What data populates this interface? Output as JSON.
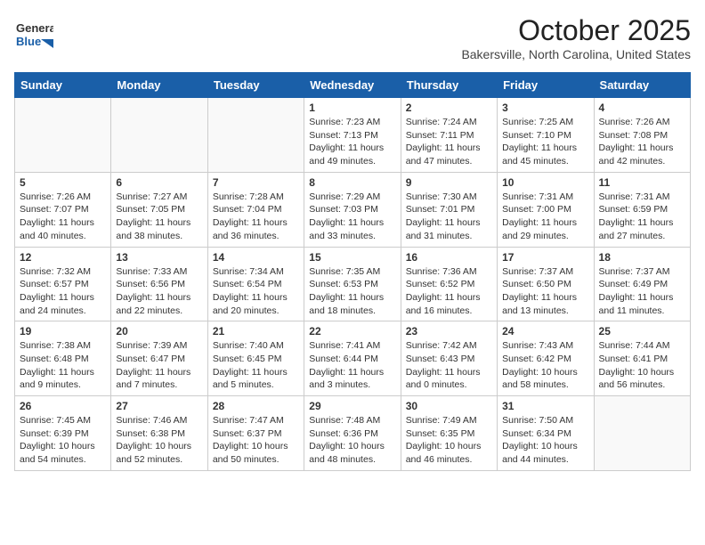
{
  "header": {
    "logo_general": "General",
    "logo_blue": "Blue",
    "month": "October 2025",
    "location": "Bakersville, North Carolina, United States"
  },
  "days_of_week": [
    "Sunday",
    "Monday",
    "Tuesday",
    "Wednesday",
    "Thursday",
    "Friday",
    "Saturday"
  ],
  "weeks": [
    [
      {
        "num": "",
        "info": ""
      },
      {
        "num": "",
        "info": ""
      },
      {
        "num": "",
        "info": ""
      },
      {
        "num": "1",
        "info": "Sunrise: 7:23 AM\nSunset: 7:13 PM\nDaylight: 11 hours and 49 minutes."
      },
      {
        "num": "2",
        "info": "Sunrise: 7:24 AM\nSunset: 7:11 PM\nDaylight: 11 hours and 47 minutes."
      },
      {
        "num": "3",
        "info": "Sunrise: 7:25 AM\nSunset: 7:10 PM\nDaylight: 11 hours and 45 minutes."
      },
      {
        "num": "4",
        "info": "Sunrise: 7:26 AM\nSunset: 7:08 PM\nDaylight: 11 hours and 42 minutes."
      }
    ],
    [
      {
        "num": "5",
        "info": "Sunrise: 7:26 AM\nSunset: 7:07 PM\nDaylight: 11 hours and 40 minutes."
      },
      {
        "num": "6",
        "info": "Sunrise: 7:27 AM\nSunset: 7:05 PM\nDaylight: 11 hours and 38 minutes."
      },
      {
        "num": "7",
        "info": "Sunrise: 7:28 AM\nSunset: 7:04 PM\nDaylight: 11 hours and 36 minutes."
      },
      {
        "num": "8",
        "info": "Sunrise: 7:29 AM\nSunset: 7:03 PM\nDaylight: 11 hours and 33 minutes."
      },
      {
        "num": "9",
        "info": "Sunrise: 7:30 AM\nSunset: 7:01 PM\nDaylight: 11 hours and 31 minutes."
      },
      {
        "num": "10",
        "info": "Sunrise: 7:31 AM\nSunset: 7:00 PM\nDaylight: 11 hours and 29 minutes."
      },
      {
        "num": "11",
        "info": "Sunrise: 7:31 AM\nSunset: 6:59 PM\nDaylight: 11 hours and 27 minutes."
      }
    ],
    [
      {
        "num": "12",
        "info": "Sunrise: 7:32 AM\nSunset: 6:57 PM\nDaylight: 11 hours and 24 minutes."
      },
      {
        "num": "13",
        "info": "Sunrise: 7:33 AM\nSunset: 6:56 PM\nDaylight: 11 hours and 22 minutes."
      },
      {
        "num": "14",
        "info": "Sunrise: 7:34 AM\nSunset: 6:54 PM\nDaylight: 11 hours and 20 minutes."
      },
      {
        "num": "15",
        "info": "Sunrise: 7:35 AM\nSunset: 6:53 PM\nDaylight: 11 hours and 18 minutes."
      },
      {
        "num": "16",
        "info": "Sunrise: 7:36 AM\nSunset: 6:52 PM\nDaylight: 11 hours and 16 minutes."
      },
      {
        "num": "17",
        "info": "Sunrise: 7:37 AM\nSunset: 6:50 PM\nDaylight: 11 hours and 13 minutes."
      },
      {
        "num": "18",
        "info": "Sunrise: 7:37 AM\nSunset: 6:49 PM\nDaylight: 11 hours and 11 minutes."
      }
    ],
    [
      {
        "num": "19",
        "info": "Sunrise: 7:38 AM\nSunset: 6:48 PM\nDaylight: 11 hours and 9 minutes."
      },
      {
        "num": "20",
        "info": "Sunrise: 7:39 AM\nSunset: 6:47 PM\nDaylight: 11 hours and 7 minutes."
      },
      {
        "num": "21",
        "info": "Sunrise: 7:40 AM\nSunset: 6:45 PM\nDaylight: 11 hours and 5 minutes."
      },
      {
        "num": "22",
        "info": "Sunrise: 7:41 AM\nSunset: 6:44 PM\nDaylight: 11 hours and 3 minutes."
      },
      {
        "num": "23",
        "info": "Sunrise: 7:42 AM\nSunset: 6:43 PM\nDaylight: 11 hours and 0 minutes."
      },
      {
        "num": "24",
        "info": "Sunrise: 7:43 AM\nSunset: 6:42 PM\nDaylight: 10 hours and 58 minutes."
      },
      {
        "num": "25",
        "info": "Sunrise: 7:44 AM\nSunset: 6:41 PM\nDaylight: 10 hours and 56 minutes."
      }
    ],
    [
      {
        "num": "26",
        "info": "Sunrise: 7:45 AM\nSunset: 6:39 PM\nDaylight: 10 hours and 54 minutes."
      },
      {
        "num": "27",
        "info": "Sunrise: 7:46 AM\nSunset: 6:38 PM\nDaylight: 10 hours and 52 minutes."
      },
      {
        "num": "28",
        "info": "Sunrise: 7:47 AM\nSunset: 6:37 PM\nDaylight: 10 hours and 50 minutes."
      },
      {
        "num": "29",
        "info": "Sunrise: 7:48 AM\nSunset: 6:36 PM\nDaylight: 10 hours and 48 minutes."
      },
      {
        "num": "30",
        "info": "Sunrise: 7:49 AM\nSunset: 6:35 PM\nDaylight: 10 hours and 46 minutes."
      },
      {
        "num": "31",
        "info": "Sunrise: 7:50 AM\nSunset: 6:34 PM\nDaylight: 10 hours and 44 minutes."
      },
      {
        "num": "",
        "info": ""
      }
    ]
  ]
}
